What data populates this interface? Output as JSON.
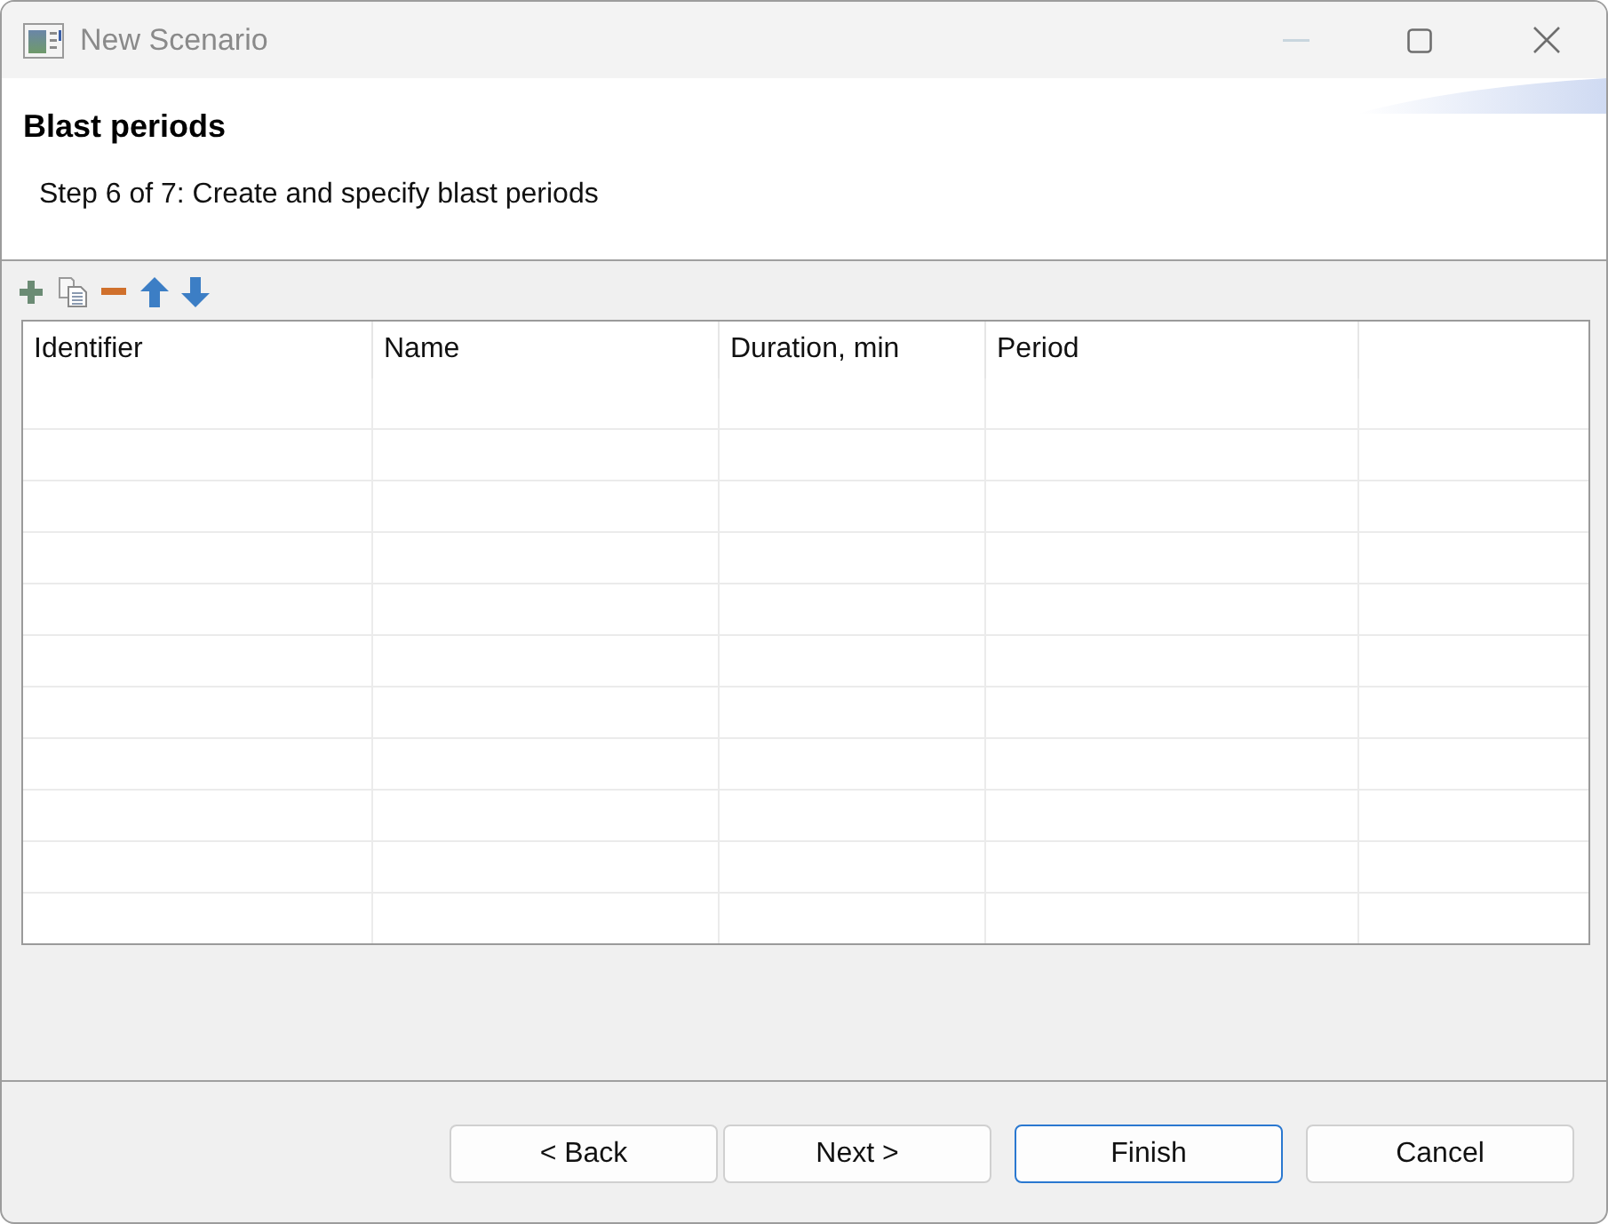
{
  "window": {
    "title": "New Scenario",
    "minimize_disabled": true
  },
  "header": {
    "title": "Blast periods",
    "description": "Step 6 of 7: Create and specify blast periods"
  },
  "table": {
    "columns": [
      "Identifier",
      "Name",
      "Duration, min",
      "Period"
    ]
  },
  "buttons": [
    {
      "label": "< Back",
      "default": false
    },
    {
      "label": "Next >",
      "default": false
    },
    {
      "label": "Finish",
      "default": true
    },
    {
      "label": "Cancel",
      "default": false
    }
  ]
}
